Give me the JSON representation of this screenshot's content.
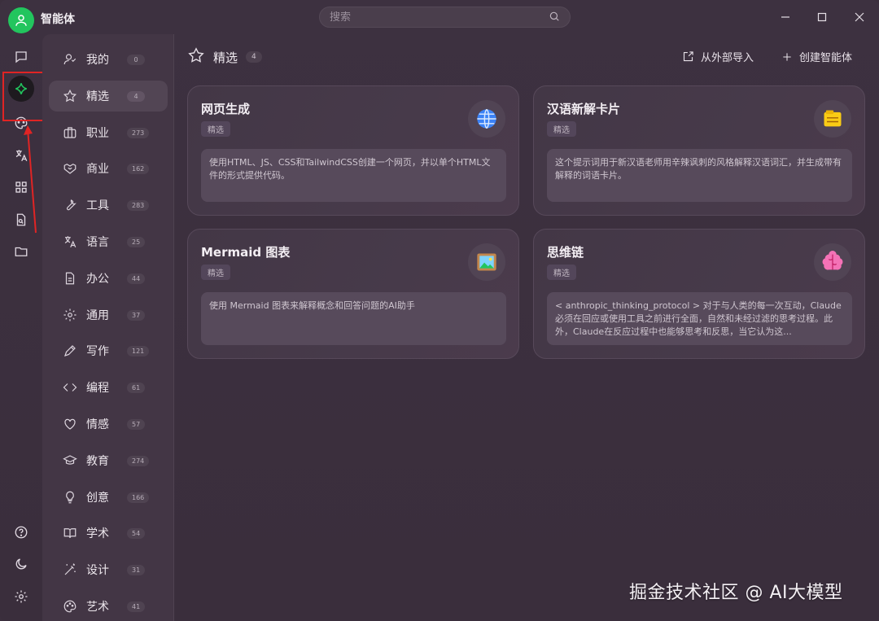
{
  "app": {
    "title": "智能体",
    "search_placeholder": "搜索"
  },
  "colors": {
    "accent_green": "#22c55e",
    "highlight_red": "#e02424"
  },
  "rail_icons": [
    "chat-icon",
    "sparkle-icon",
    "palette-icon",
    "translate-icon",
    "apps-grid-icon",
    "document-search-icon",
    "folder-icon",
    "help-icon",
    "moon-icon",
    "settings-icon"
  ],
  "categories": [
    {
      "label": "我的",
      "count": "0",
      "icon": "user-icon"
    },
    {
      "label": "精选",
      "count": "4",
      "icon": "star-icon"
    },
    {
      "label": "职业",
      "count": "273",
      "icon": "briefcase-icon"
    },
    {
      "label": "商业",
      "count": "162",
      "icon": "handshake-icon"
    },
    {
      "label": "工具",
      "count": "283",
      "icon": "wrench-icon"
    },
    {
      "label": "语言",
      "count": "25",
      "icon": "translate-icon"
    },
    {
      "label": "办公",
      "count": "44",
      "icon": "document-icon"
    },
    {
      "label": "通用",
      "count": "37",
      "icon": "gear-icon"
    },
    {
      "label": "写作",
      "count": "121",
      "icon": "pen-icon"
    },
    {
      "label": "编程",
      "count": "61",
      "icon": "code-icon"
    },
    {
      "label": "情感",
      "count": "57",
      "icon": "heart-icon"
    },
    {
      "label": "教育",
      "count": "274",
      "icon": "graduation-cap-icon"
    },
    {
      "label": "创意",
      "count": "166",
      "icon": "lightbulb-icon"
    },
    {
      "label": "学术",
      "count": "54",
      "icon": "book-icon"
    },
    {
      "label": "设计",
      "count": "31",
      "icon": "magic-wand-icon"
    },
    {
      "label": "艺术",
      "count": "41",
      "icon": "palette-icon"
    }
  ],
  "main": {
    "title": "精选",
    "count": "4",
    "import_label": "从外部导入",
    "create_label": "创建智能体"
  },
  "cards": [
    {
      "title": "网页生成",
      "tag": "精选",
      "emoji": "🌐",
      "description": "使用HTML、JS、CSS和TailwindCSS创建一个网页，并以单个HTML文件的形式提供代码。"
    },
    {
      "title": "汉语新解卡片",
      "tag": "精选",
      "emoji": "🗂️",
      "description": "这个提示词用于新汉语老师用辛辣讽刺的风格解释汉语词汇，并生成带有解释的词语卡片。"
    },
    {
      "title": "Mermaid 图表",
      "tag": "精选",
      "emoji": "🖼️",
      "description": "使用 Mermaid 图表来解释概念和回答问题的AI助手"
    },
    {
      "title": "思维链",
      "tag": "精选",
      "emoji": "🧠",
      "description": "< anthropic_thinking_protocol > 对于与人类的每一次互动，Claude必须在回应或使用工具之前进行全面，自然和未经过滤的思考过程。此外，Claude在反应过程中也能够思考和反思，当它认为这..."
    }
  ],
  "watermark": "掘金技术社区 @ AI大模型"
}
